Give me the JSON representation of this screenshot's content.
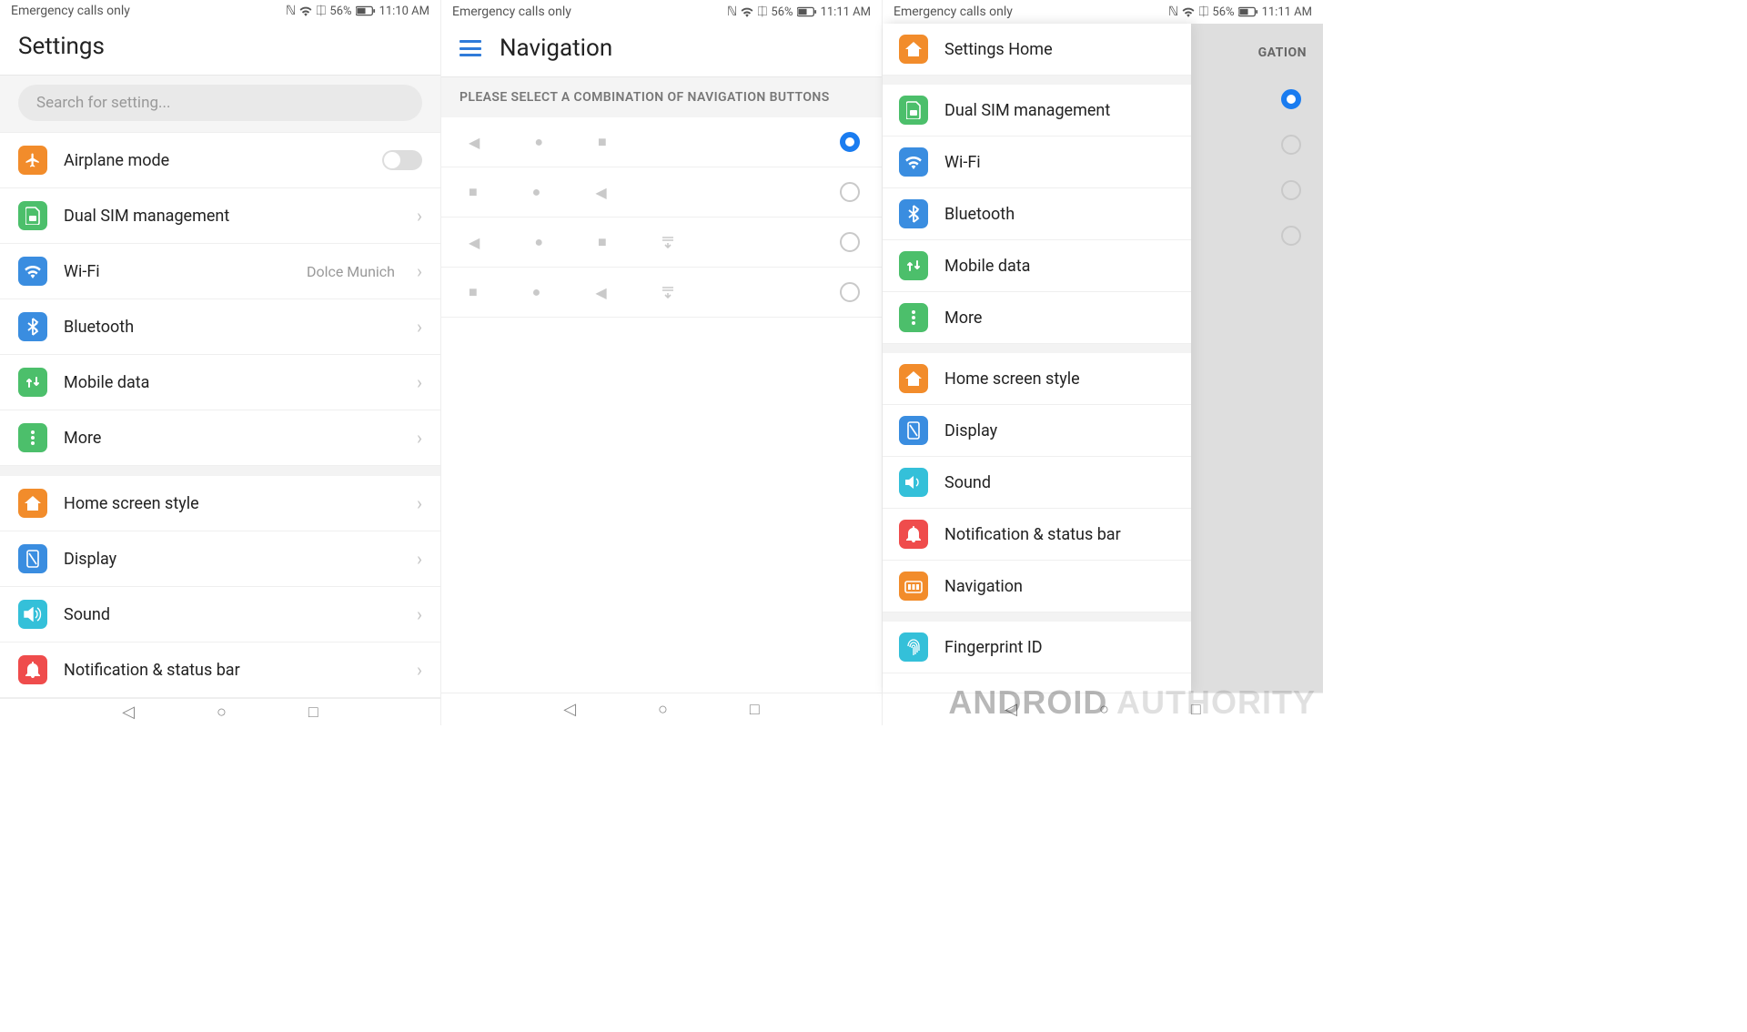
{
  "status": {
    "left": "Emergency calls only",
    "battery": "56%",
    "time1": "11:10 AM",
    "time2": "11:11 AM"
  },
  "screen1": {
    "title": "Settings",
    "search_placeholder": "Search for setting...",
    "items": [
      {
        "label": "Airplane mode"
      },
      {
        "label": "Dual SIM management"
      },
      {
        "label": "Wi-Fi",
        "value": "Dolce Munich"
      },
      {
        "label": "Bluetooth"
      },
      {
        "label": "Mobile data"
      },
      {
        "label": "More"
      },
      {
        "label": "Home screen style"
      },
      {
        "label": "Display"
      },
      {
        "label": "Sound"
      },
      {
        "label": "Notification & status bar"
      }
    ]
  },
  "screen2": {
    "title": "Navigation",
    "subtitle": "PLEASE SELECT A COMBINATION OF NAVIGATION BUTTONS"
  },
  "screen3": {
    "partial_title": "GATION",
    "drawer": [
      "Settings Home",
      "Dual SIM management",
      "Wi-Fi",
      "Bluetooth",
      "Mobile data",
      "More",
      "Home screen style",
      "Display",
      "Sound",
      "Notification & status bar",
      "Navigation",
      "Fingerprint ID"
    ]
  },
  "watermark_a": "ANDROID",
  "watermark_b": "AUTHORITY"
}
